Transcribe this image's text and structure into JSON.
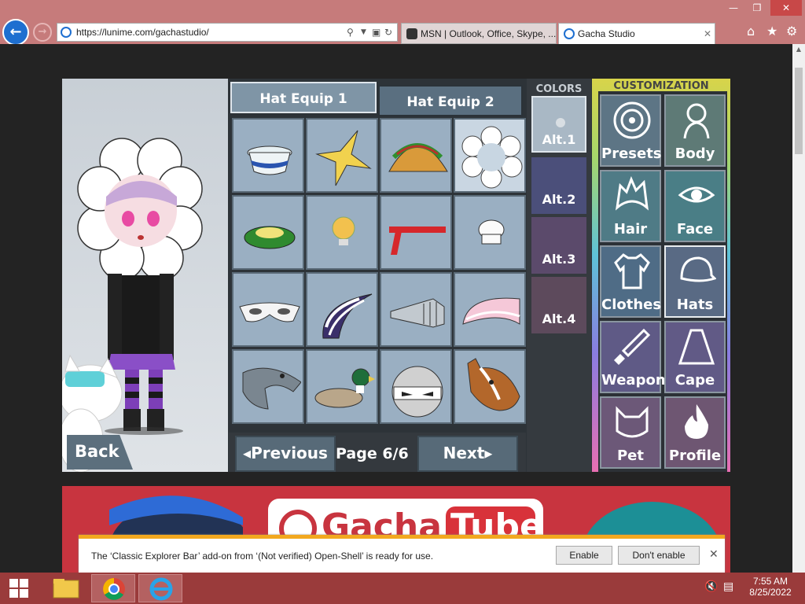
{
  "browser": {
    "url": "https://lunime.com/gachastudio/",
    "tabs": [
      {
        "title": "MSN | Outlook, Office, Skype, ...",
        "active": false
      },
      {
        "title": "Gacha Studio",
        "active": true
      }
    ],
    "window_controls": {
      "minimize": "—",
      "restore": "❐",
      "close": "✕"
    }
  },
  "game": {
    "back_label": "Back",
    "equip_tabs": [
      {
        "label": "Hat Equip 1",
        "active": false
      },
      {
        "label": "Hat Equip 2",
        "active": true
      }
    ],
    "items": [
      {
        "name": "sailor-hat",
        "selected": false
      },
      {
        "name": "gold-star",
        "selected": false
      },
      {
        "name": "taco",
        "selected": false
      },
      {
        "name": "flower-hood",
        "selected": true
      },
      {
        "name": "sunflower-pad",
        "selected": false
      },
      {
        "name": "lightbulb",
        "selected": false
      },
      {
        "name": "red-headband",
        "selected": false
      },
      {
        "name": "chef-hat",
        "selected": false
      },
      {
        "name": "eye-mask",
        "selected": false
      },
      {
        "name": "striped-hat",
        "selected": false
      },
      {
        "name": "knight-visor",
        "selected": false
      },
      {
        "name": "pink-beanie",
        "selected": false
      },
      {
        "name": "dolphin-hat",
        "selected": false
      },
      {
        "name": "duck-hat",
        "selected": false
      },
      {
        "name": "robot-ball",
        "selected": false
      },
      {
        "name": "horse-mask",
        "selected": false
      }
    ],
    "pagination": {
      "previous": "Previous",
      "next": "Next",
      "page_label": "Page 6/6"
    },
    "colors": {
      "title": "COLORS",
      "swatches": [
        {
          "label": "Alt.1",
          "color": "#a9b8c5"
        },
        {
          "label": "Alt.2",
          "color": "#4b4f7a"
        },
        {
          "label": "Alt.3",
          "color": "#5b4a6b"
        },
        {
          "label": "Alt.4",
          "color": "#5d4a5c"
        }
      ]
    },
    "customization": {
      "title": "CUSTOMIZATION",
      "buttons": [
        {
          "label": "Presets",
          "icon": "presets-icon",
          "active": false
        },
        {
          "label": "Body",
          "icon": "body-icon",
          "active": false
        },
        {
          "label": "Hair",
          "icon": "hair-icon",
          "active": false
        },
        {
          "label": "Face",
          "icon": "face-icon",
          "active": false
        },
        {
          "label": "Clothes",
          "icon": "clothes-icon",
          "active": false
        },
        {
          "label": "Hats",
          "icon": "hat-icon",
          "active": true
        },
        {
          "label": "Weapon",
          "icon": "weapon-icon",
          "active": false
        },
        {
          "label": "Cape",
          "icon": "cape-icon",
          "active": false
        },
        {
          "label": "Pet",
          "icon": "pet-icon",
          "active": false
        },
        {
          "label": "Profile",
          "icon": "profile-icon",
          "active": false
        }
      ]
    }
  },
  "banner": {
    "text_left": "Gacha",
    "text_right": "Tube"
  },
  "notification": {
    "message": "The ‘Classic Explorer Bar’ add-on from ‘(Not verified) Open-Shell’ is ready for use.",
    "enable": "Enable",
    "dont_enable": "Don't enable",
    "close": "✕"
  },
  "taskbar": {
    "time": "7:55 AM",
    "date": "8/25/2022"
  },
  "accent_colors": {
    "titlebar": "#c67b7b",
    "taskbar": "#9a3b3b",
    "notif_bar": "#f2a81f"
  }
}
